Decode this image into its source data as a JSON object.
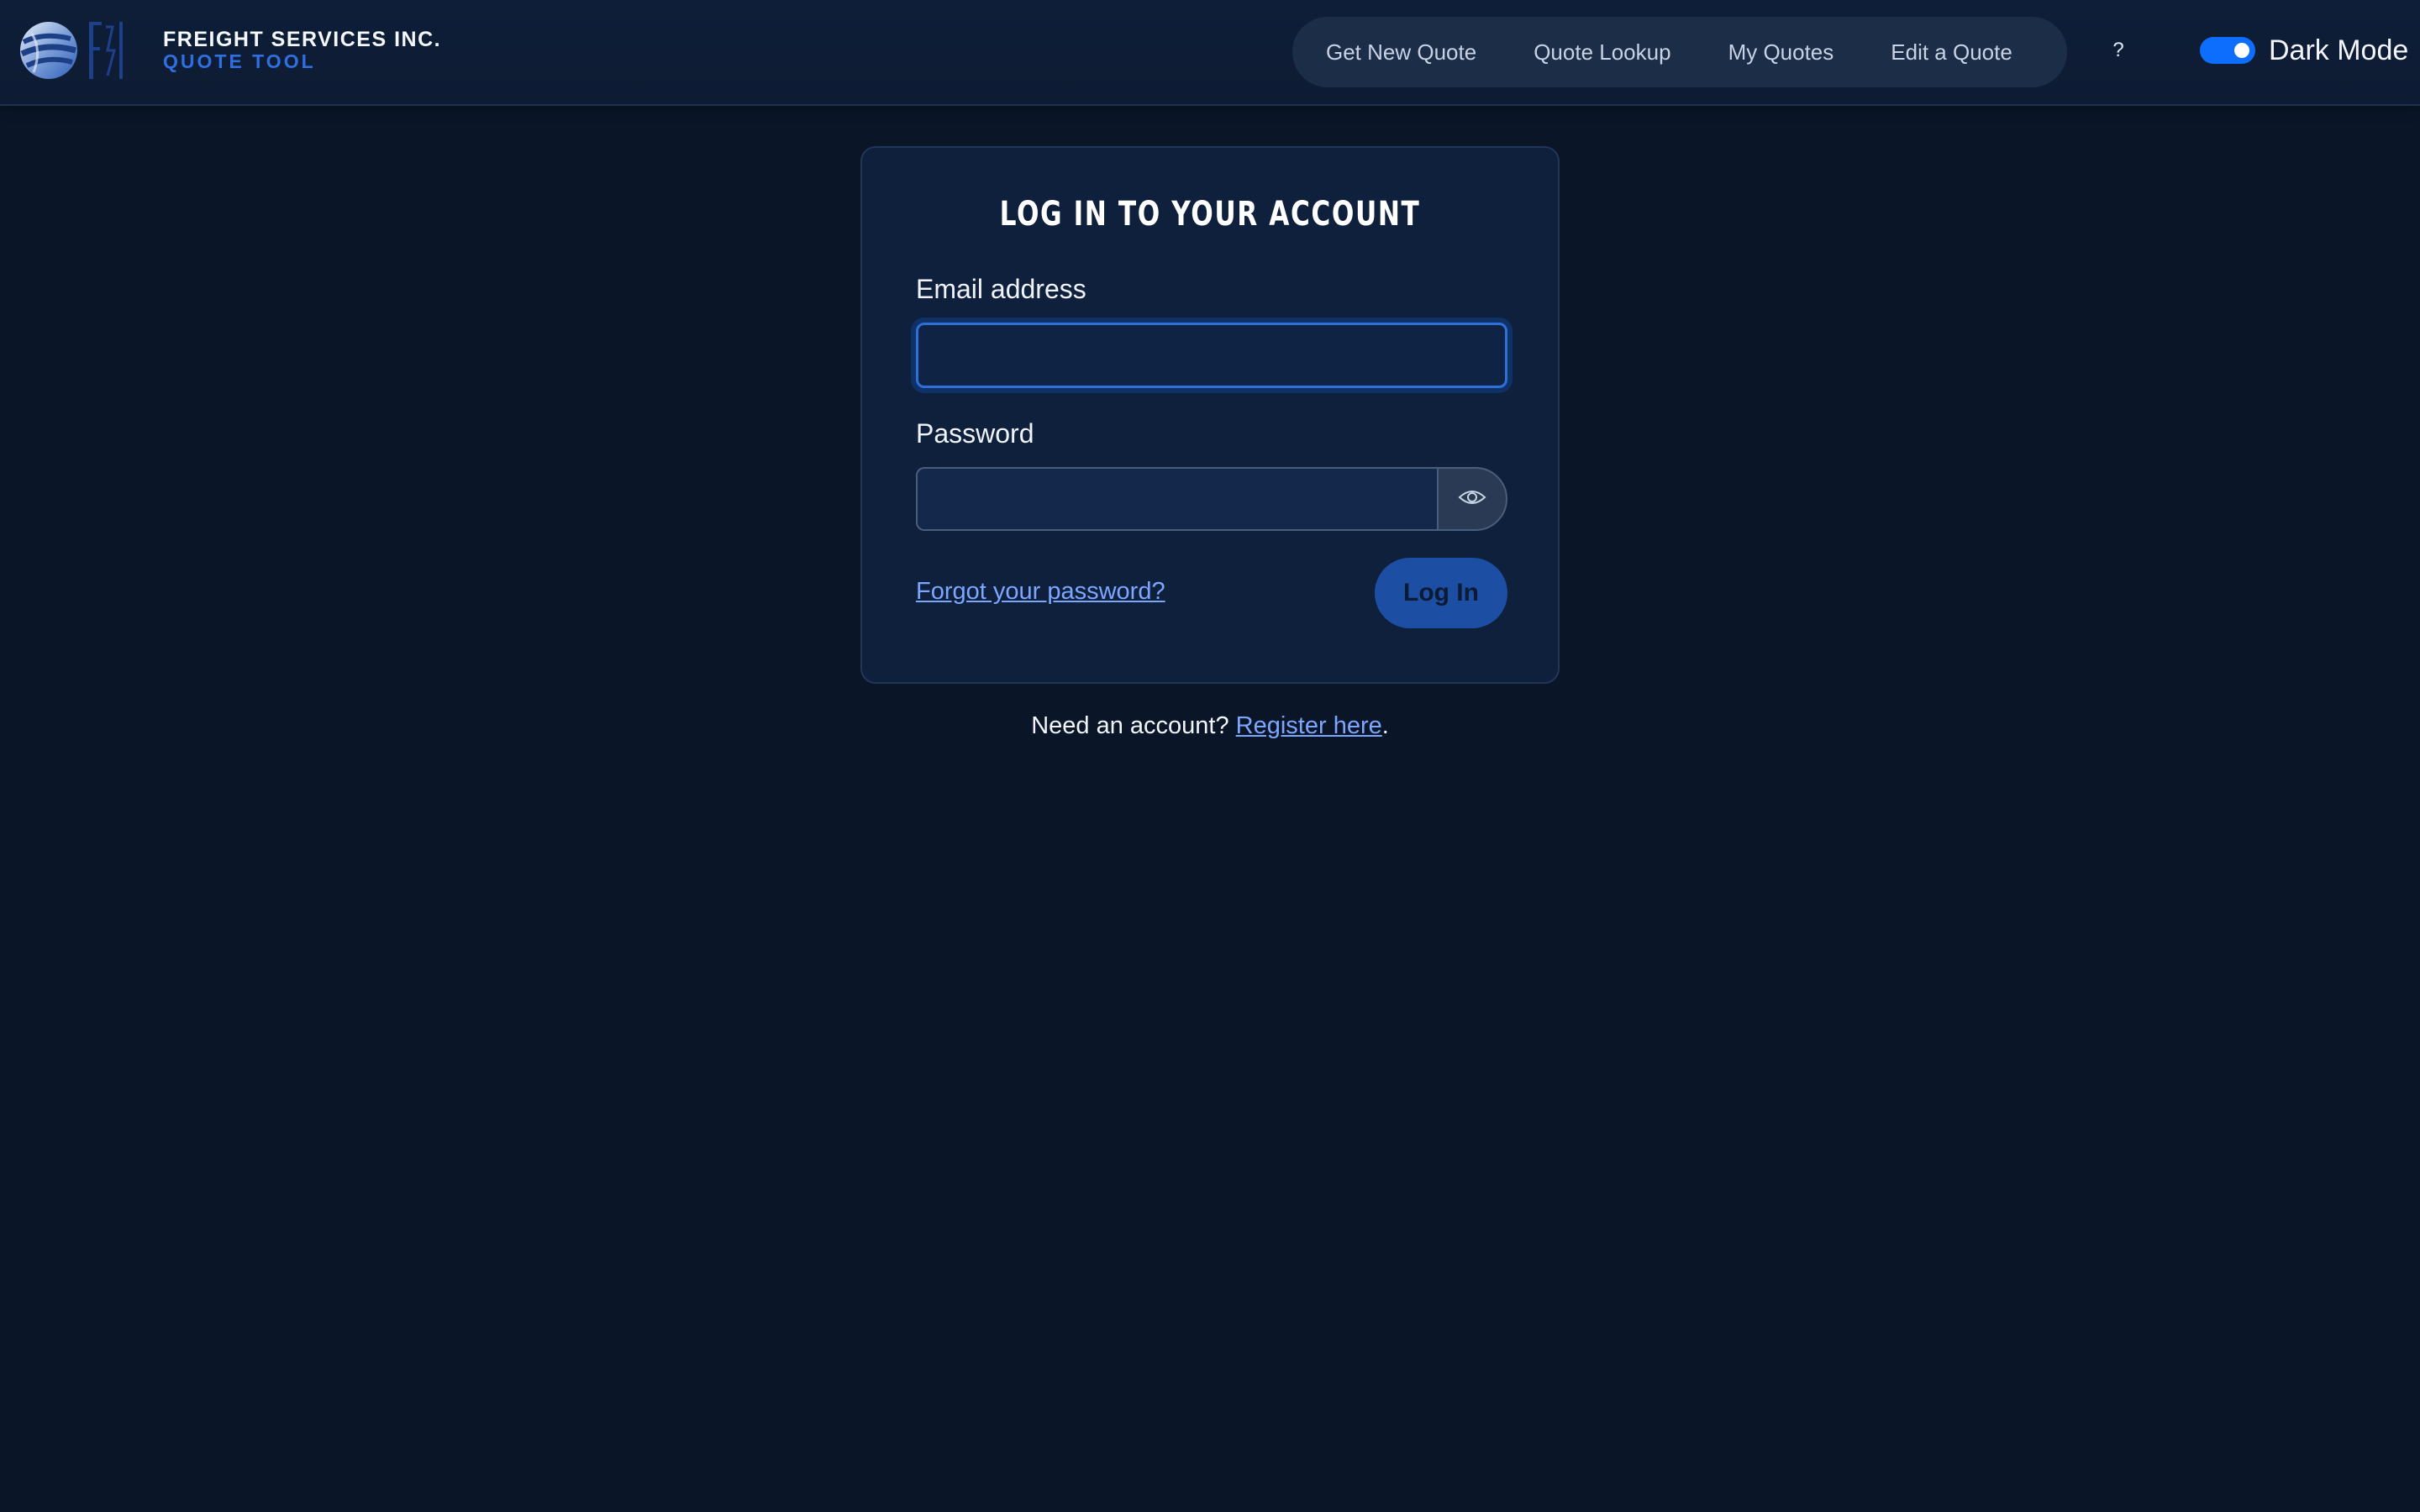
{
  "app": {
    "company": "FREIGHT SERVICES INC.",
    "product": "QUOTE TOOL",
    "logo_icon": "globe-fsi-logo"
  },
  "nav": {
    "items": [
      {
        "label": "Get New Quote"
      },
      {
        "label": "Quote Lookup"
      },
      {
        "label": "My Quotes"
      },
      {
        "label": "Edit a Quote"
      }
    ],
    "help_label": "?"
  },
  "theme_toggle": {
    "label": "Dark Mode",
    "on": true,
    "accent": "#0d6efd"
  },
  "login": {
    "title": "LOG IN TO YOUR ACCOUNT",
    "email_label": "Email address",
    "email_value": "",
    "password_label": "Password",
    "password_value": "",
    "toggle_visibility_icon": "eye-icon",
    "forgot_link": "Forgot your password?",
    "submit_label": "Log In"
  },
  "register": {
    "prompt": "Need an account?",
    "link": "Register here",
    "suffix": "."
  },
  "colors": {
    "background": "#0a1628",
    "card": "#0f203d",
    "link": "#7da6ff",
    "primary_button": "#1c4fa3"
  }
}
